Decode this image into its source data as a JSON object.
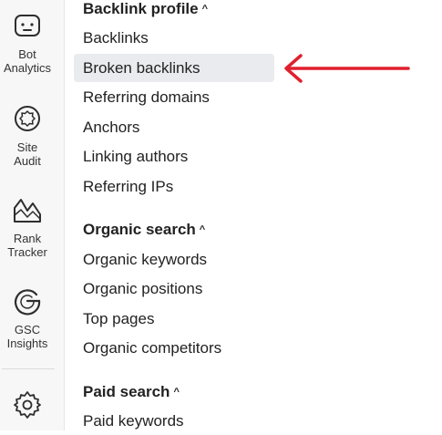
{
  "rail": {
    "items": [
      {
        "icon": "bot-icon",
        "label_line1": "Bot",
        "label_line2": "Analytics"
      },
      {
        "icon": "site-audit-icon",
        "label_line1": "Site",
        "label_line2": "Audit"
      },
      {
        "icon": "rank-tracker-icon",
        "label_line1": "Rank",
        "label_line2": "Tracker"
      },
      {
        "icon": "gsc-icon",
        "label_line1": "GSC",
        "label_line2": "Insights"
      },
      {
        "icon": "settings-icon"
      }
    ]
  },
  "menu": {
    "sections": [
      {
        "title": "Backlink profile",
        "caret": "^",
        "items": [
          "Backlinks",
          "Broken backlinks",
          "Referring domains",
          "Anchors",
          "Linking authors",
          "Referring IPs"
        ]
      },
      {
        "title": "Organic search",
        "caret": "^",
        "items": [
          "Organic keywords",
          "Organic positions",
          "Top pages",
          "Organic competitors"
        ]
      },
      {
        "title": "Paid search",
        "caret": "^",
        "items": [
          "Paid keywords"
        ]
      }
    ],
    "active_item": "Broken backlinks"
  },
  "annotation": {
    "arrow_color": "#e0202e"
  },
  "colors": {
    "active_bg": "#e9ebef",
    "rail_bg": "#f7f7f7"
  }
}
